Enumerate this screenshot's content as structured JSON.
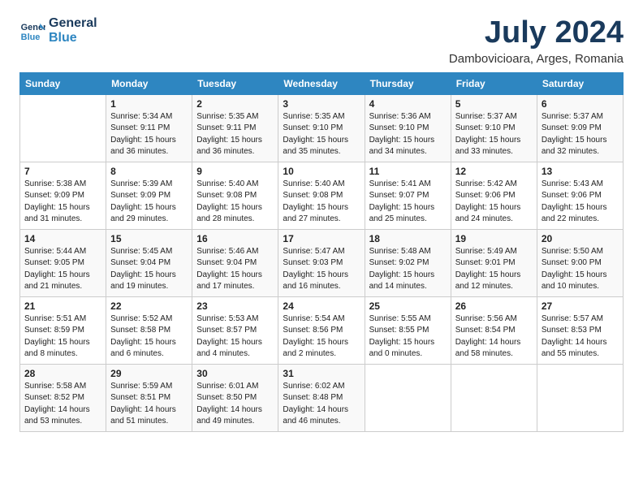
{
  "logo": {
    "line1": "General",
    "line2": "Blue"
  },
  "title": "July 2024",
  "location": "Dambovicioara, Arges, Romania",
  "weekdays": [
    "Sunday",
    "Monday",
    "Tuesday",
    "Wednesday",
    "Thursday",
    "Friday",
    "Saturday"
  ],
  "weeks": [
    [
      {
        "day": "",
        "sunrise": "",
        "sunset": "",
        "daylight": ""
      },
      {
        "day": "1",
        "sunrise": "5:34 AM",
        "sunset": "9:11 PM",
        "daylight": "15 hours and 36 minutes."
      },
      {
        "day": "2",
        "sunrise": "5:35 AM",
        "sunset": "9:11 PM",
        "daylight": "15 hours and 36 minutes."
      },
      {
        "day": "3",
        "sunrise": "5:35 AM",
        "sunset": "9:10 PM",
        "daylight": "15 hours and 35 minutes."
      },
      {
        "day": "4",
        "sunrise": "5:36 AM",
        "sunset": "9:10 PM",
        "daylight": "15 hours and 34 minutes."
      },
      {
        "day": "5",
        "sunrise": "5:37 AM",
        "sunset": "9:10 PM",
        "daylight": "15 hours and 33 minutes."
      },
      {
        "day": "6",
        "sunrise": "5:37 AM",
        "sunset": "9:09 PM",
        "daylight": "15 hours and 32 minutes."
      }
    ],
    [
      {
        "day": "7",
        "sunrise": "5:38 AM",
        "sunset": "9:09 PM",
        "daylight": "15 hours and 31 minutes."
      },
      {
        "day": "8",
        "sunrise": "5:39 AM",
        "sunset": "9:09 PM",
        "daylight": "15 hours and 29 minutes."
      },
      {
        "day": "9",
        "sunrise": "5:40 AM",
        "sunset": "9:08 PM",
        "daylight": "15 hours and 28 minutes."
      },
      {
        "day": "10",
        "sunrise": "5:40 AM",
        "sunset": "9:08 PM",
        "daylight": "15 hours and 27 minutes."
      },
      {
        "day": "11",
        "sunrise": "5:41 AM",
        "sunset": "9:07 PM",
        "daylight": "15 hours and 25 minutes."
      },
      {
        "day": "12",
        "sunrise": "5:42 AM",
        "sunset": "9:06 PM",
        "daylight": "15 hours and 24 minutes."
      },
      {
        "day": "13",
        "sunrise": "5:43 AM",
        "sunset": "9:06 PM",
        "daylight": "15 hours and 22 minutes."
      }
    ],
    [
      {
        "day": "14",
        "sunrise": "5:44 AM",
        "sunset": "9:05 PM",
        "daylight": "15 hours and 21 minutes."
      },
      {
        "day": "15",
        "sunrise": "5:45 AM",
        "sunset": "9:04 PM",
        "daylight": "15 hours and 19 minutes."
      },
      {
        "day": "16",
        "sunrise": "5:46 AM",
        "sunset": "9:04 PM",
        "daylight": "15 hours and 17 minutes."
      },
      {
        "day": "17",
        "sunrise": "5:47 AM",
        "sunset": "9:03 PM",
        "daylight": "15 hours and 16 minutes."
      },
      {
        "day": "18",
        "sunrise": "5:48 AM",
        "sunset": "9:02 PM",
        "daylight": "15 hours and 14 minutes."
      },
      {
        "day": "19",
        "sunrise": "5:49 AM",
        "sunset": "9:01 PM",
        "daylight": "15 hours and 12 minutes."
      },
      {
        "day": "20",
        "sunrise": "5:50 AM",
        "sunset": "9:00 PM",
        "daylight": "15 hours and 10 minutes."
      }
    ],
    [
      {
        "day": "21",
        "sunrise": "5:51 AM",
        "sunset": "8:59 PM",
        "daylight": "15 hours and 8 minutes."
      },
      {
        "day": "22",
        "sunrise": "5:52 AM",
        "sunset": "8:58 PM",
        "daylight": "15 hours and 6 minutes."
      },
      {
        "day": "23",
        "sunrise": "5:53 AM",
        "sunset": "8:57 PM",
        "daylight": "15 hours and 4 minutes."
      },
      {
        "day": "24",
        "sunrise": "5:54 AM",
        "sunset": "8:56 PM",
        "daylight": "15 hours and 2 minutes."
      },
      {
        "day": "25",
        "sunrise": "5:55 AM",
        "sunset": "8:55 PM",
        "daylight": "15 hours and 0 minutes."
      },
      {
        "day": "26",
        "sunrise": "5:56 AM",
        "sunset": "8:54 PM",
        "daylight": "14 hours and 58 minutes."
      },
      {
        "day": "27",
        "sunrise": "5:57 AM",
        "sunset": "8:53 PM",
        "daylight": "14 hours and 55 minutes."
      }
    ],
    [
      {
        "day": "28",
        "sunrise": "5:58 AM",
        "sunset": "8:52 PM",
        "daylight": "14 hours and 53 minutes."
      },
      {
        "day": "29",
        "sunrise": "5:59 AM",
        "sunset": "8:51 PM",
        "daylight": "14 hours and 51 minutes."
      },
      {
        "day": "30",
        "sunrise": "6:01 AM",
        "sunset": "8:50 PM",
        "daylight": "14 hours and 49 minutes."
      },
      {
        "day": "31",
        "sunrise": "6:02 AM",
        "sunset": "8:48 PM",
        "daylight": "14 hours and 46 minutes."
      },
      {
        "day": "",
        "sunrise": "",
        "sunset": "",
        "daylight": ""
      },
      {
        "day": "",
        "sunrise": "",
        "sunset": "",
        "daylight": ""
      },
      {
        "day": "",
        "sunrise": "",
        "sunset": "",
        "daylight": ""
      }
    ]
  ]
}
